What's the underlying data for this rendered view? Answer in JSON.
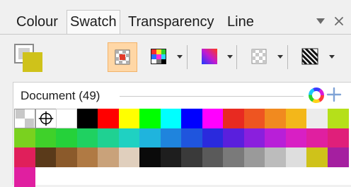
{
  "tabs": [
    {
      "label": "Colour"
    },
    {
      "label": "Swatch",
      "active": true
    },
    {
      "label": "Transparency"
    },
    {
      "label": "Line"
    }
  ],
  "controls": {
    "menu_icon": "triangle-down-icon",
    "close_icon": "close-icon"
  },
  "toolbar": {
    "fill_stroke_icon": "fill-stroke-icon",
    "buttons": [
      {
        "icon": "checker-swatch-icon",
        "selected": true
      },
      {
        "icon": "color-palette-icon"
      },
      {
        "icon": "gradient-icon"
      },
      {
        "icon": "transparency-checker-icon"
      },
      {
        "icon": "hatch-pattern-icon"
      }
    ]
  },
  "palette": {
    "title": "Document (49)",
    "add_icon": "plus-icon",
    "ring_icon": "color-ring-icon"
  },
  "swatches": [
    {
      "color": "special-none"
    },
    {
      "color": "special-registration"
    },
    {
      "color": "#ffffff"
    },
    {
      "color": "#000000"
    },
    {
      "color": "#ff0000"
    },
    {
      "color": "#ffff00"
    },
    {
      "color": "#00ff00"
    },
    {
      "color": "#00ffff"
    },
    {
      "color": "#0000ff"
    },
    {
      "color": "#ff00ff"
    },
    {
      "color": "#e82a21"
    },
    {
      "color": "#ee5521"
    },
    {
      "color": "#f18a1f"
    },
    {
      "color": "#f3b71a"
    },
    {
      "color": "#ececec"
    },
    {
      "color": "#b5e01a"
    },
    {
      "color": "#7ad11f"
    },
    {
      "color": "#3fd12a"
    },
    {
      "color": "#25d13a"
    },
    {
      "color": "#1fd161"
    },
    {
      "color": "#1fd192"
    },
    {
      "color": "#1fd1c2"
    },
    {
      "color": "#1fb4dd"
    },
    {
      "color": "#1f84dd"
    },
    {
      "color": "#1f55dd"
    },
    {
      "color": "#2a2add"
    },
    {
      "color": "#5a1fdd"
    },
    {
      "color": "#8a1fdd"
    },
    {
      "color": "#b81fd8"
    },
    {
      "color": "#d81fc4"
    },
    {
      "color": "#e01fa0"
    },
    {
      "color": "#e01f7a"
    },
    {
      "color": "#e01f5b"
    },
    {
      "color": "#5a3a1a"
    },
    {
      "color": "#8b5a2b"
    },
    {
      "color": "#b07a44"
    },
    {
      "color": "#c9a27a"
    },
    {
      "color": "#e0cfbd"
    },
    {
      "color": "#0a0a0a"
    },
    {
      "color": "#1e1e1e"
    },
    {
      "color": "#3a3a3a"
    },
    {
      "color": "#5a5a5a"
    },
    {
      "color": "#7a7a7a"
    },
    {
      "color": "#9a9a9a"
    },
    {
      "color": "#bcbcbc"
    },
    {
      "color": "#dedede"
    },
    {
      "color": "#cfc21a"
    },
    {
      "color": "#a51fa0"
    },
    {
      "color": "#e01fa0"
    }
  ]
}
